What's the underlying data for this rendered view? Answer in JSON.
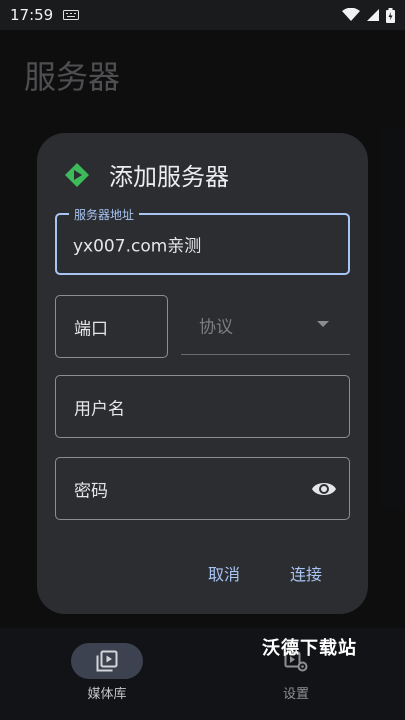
{
  "status_bar": {
    "time": "17:59"
  },
  "page": {
    "title": "服务器"
  },
  "dialog": {
    "title": "添加服务器",
    "server_field": {
      "label": "服务器地址",
      "value": "yx007.com亲测"
    },
    "port_field": {
      "placeholder": "端口"
    },
    "protocol_field": {
      "placeholder": "协议"
    },
    "username_field": {
      "placeholder": "用户名"
    },
    "password_field": {
      "placeholder": "密码"
    },
    "cancel_label": "取消",
    "connect_label": "连接"
  },
  "bottom_nav": {
    "items": [
      {
        "label": "媒体库",
        "icon": "media-library-icon",
        "selected": true
      },
      {
        "label": "设置",
        "icon": "settings-icon",
        "selected": false
      }
    ]
  },
  "watermark": "沃德下载站",
  "colors": {
    "accent": "#a8c4f2",
    "logo": "#3dba59",
    "dialog_bg": "#2b2d31"
  }
}
